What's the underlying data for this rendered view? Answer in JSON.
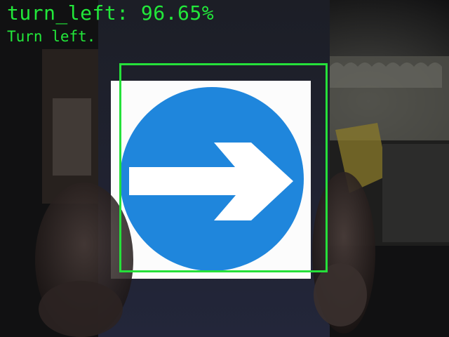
{
  "detection": {
    "label": "turn_left: 96.65%",
    "message": "Turn left.",
    "box_color": "#25e03a"
  },
  "scene": {
    "sign_color": "#1f86dc",
    "arrow_color": "#ffffff",
    "sign_icon": "arrow-right-icon"
  }
}
